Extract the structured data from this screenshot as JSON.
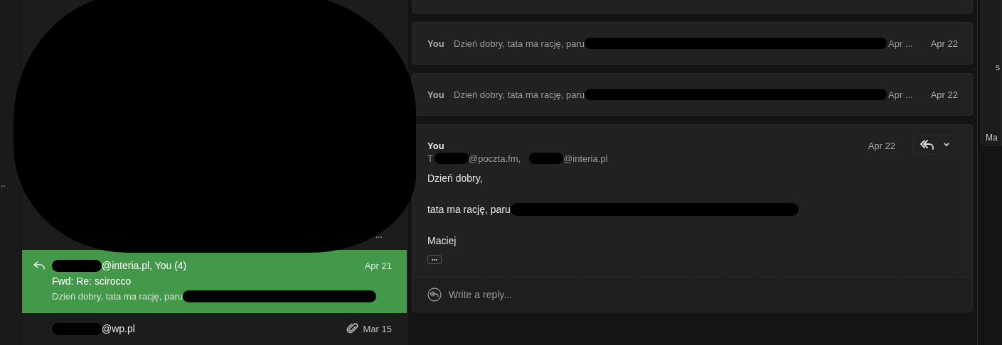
{
  "left_rail": {
    "text": ".."
  },
  "thread_list": [
    {
      "kind": "covered",
      "tail": "..."
    },
    {
      "kind": "thread",
      "selected": true,
      "replied": true,
      "attachment": false,
      "sender": "@interia.pl, You (4)",
      "date": "Apr 21",
      "subject": "Fwd: Re: scirocco",
      "preview": "Dzień dobry, tata ma rację, paru"
    },
    {
      "kind": "thread",
      "selected": false,
      "replied": false,
      "attachment": true,
      "sender": "@wp.pl",
      "date": "Mar 15"
    }
  ],
  "messages": [
    {
      "kind": "collapsed",
      "sender": "You",
      "preview": "Dzień dobry, tata ma rację, paru",
      "preview_tail": "Apr ...",
      "date": "Apr 22"
    },
    {
      "kind": "collapsed",
      "sender": "You",
      "preview": "Dzień dobry, tata ma rację, paru",
      "preview_tail": "Apr ...",
      "date": "Apr 22"
    },
    {
      "kind": "expanded",
      "sender": "You",
      "to_label": "T",
      "recipients": [
        "@poczta.fm,",
        "@interia.pl"
      ],
      "date": "Apr 22",
      "body": [
        "Dzień dobry,",
        "tata ma rację, paru",
        "Maciej"
      ],
      "more": "•••",
      "reply_placeholder": "Write a reply..."
    }
  ],
  "right_panel": {
    "texts": [
      "s",
      "Ma"
    ]
  }
}
